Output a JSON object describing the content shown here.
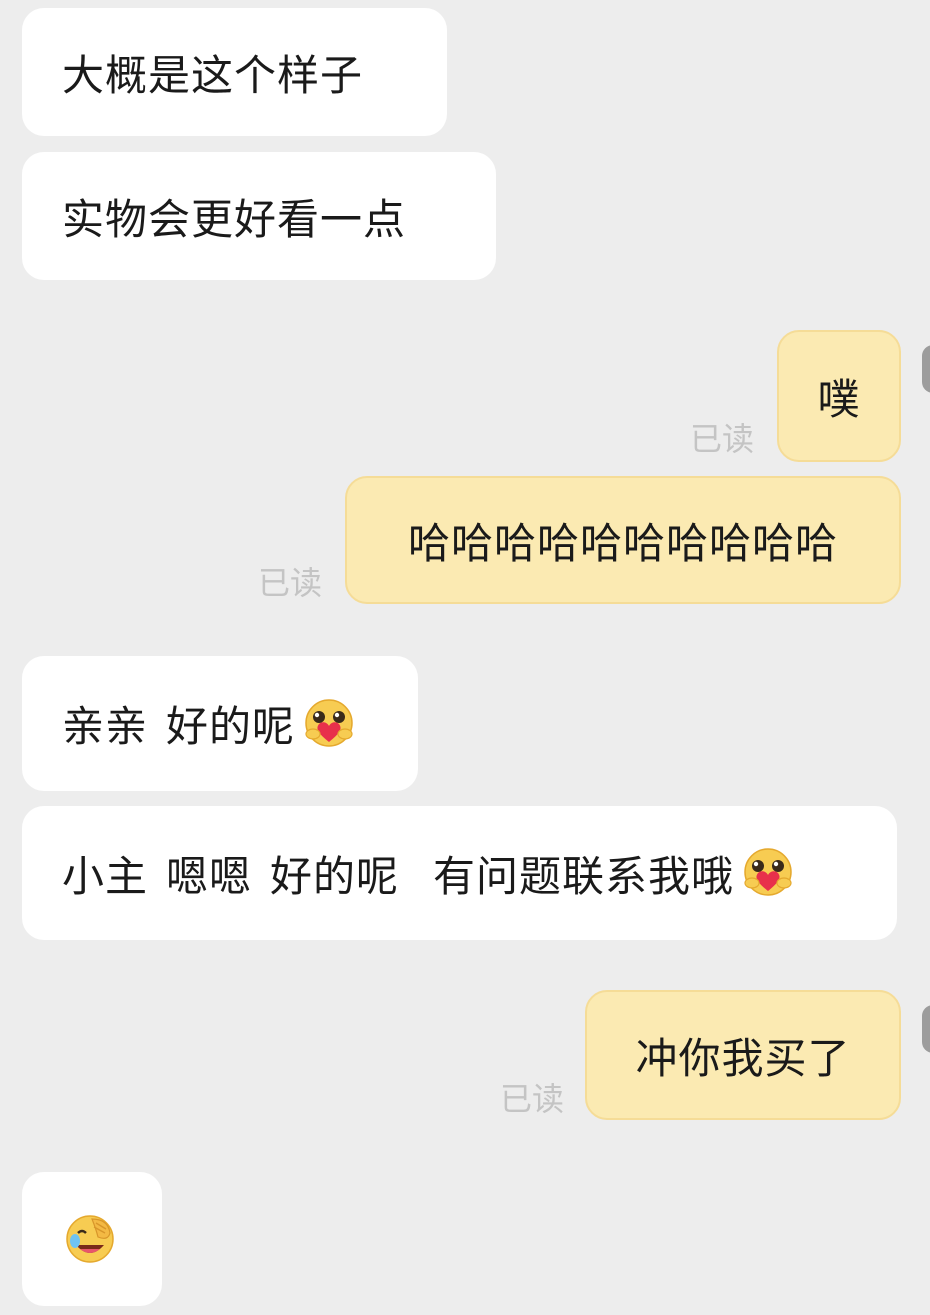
{
  "messages": [
    {
      "side": "incoming",
      "text": "大概是这个样子"
    },
    {
      "side": "incoming",
      "text": "实物会更好看一点"
    },
    {
      "side": "outgoing",
      "text": "噗",
      "status": "已读"
    },
    {
      "side": "outgoing",
      "text": "哈哈哈哈哈哈哈哈哈哈",
      "status": "已读"
    },
    {
      "side": "incoming",
      "parts": [
        "亲亲",
        "好的呢"
      ],
      "emoji": "hug-heart-emoji"
    },
    {
      "side": "incoming",
      "parts": [
        "小主",
        "嗯嗯",
        "好的呢",
        "有问题联系我哦"
      ],
      "emoji": "hug-heart-emoji"
    },
    {
      "side": "outgoing",
      "text": "冲你我买了",
      "status": "已读"
    },
    {
      "side": "incoming",
      "emoji": "facepalm-laugh-emoji"
    }
  ],
  "colors": {
    "background": "#ededed",
    "incoming_bubble": "#ffffff",
    "outgoing_bubble": "#fbeab2",
    "read_status": "#c4c4c4"
  }
}
